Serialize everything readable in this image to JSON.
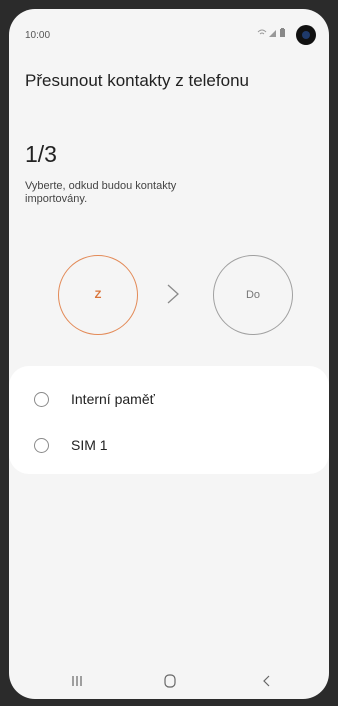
{
  "status_bar": {
    "time": "10:00",
    "icons": [
      "wifi-icon",
      "signal-icon",
      "battery-icon",
      "front-camera-icon"
    ]
  },
  "header": {
    "title": "Přesunout kontakty z telefonu"
  },
  "step": {
    "counter": "1/3",
    "instruction": "Vyberte, odkud budou kontakty importovány."
  },
  "flow": {
    "from_label": "Z",
    "to_label": "Do",
    "arrow_icon": "chevron-right-icon",
    "active_color": "#e38a57",
    "inactive_color": "#a0a0a0"
  },
  "sources": {
    "options": [
      {
        "label": "Interní paměť",
        "selected": false
      },
      {
        "label": "SIM 1",
        "selected": false
      }
    ]
  },
  "navigation_bar": {
    "buttons": [
      "recent-apps-icon",
      "home-icon",
      "back-icon"
    ]
  }
}
